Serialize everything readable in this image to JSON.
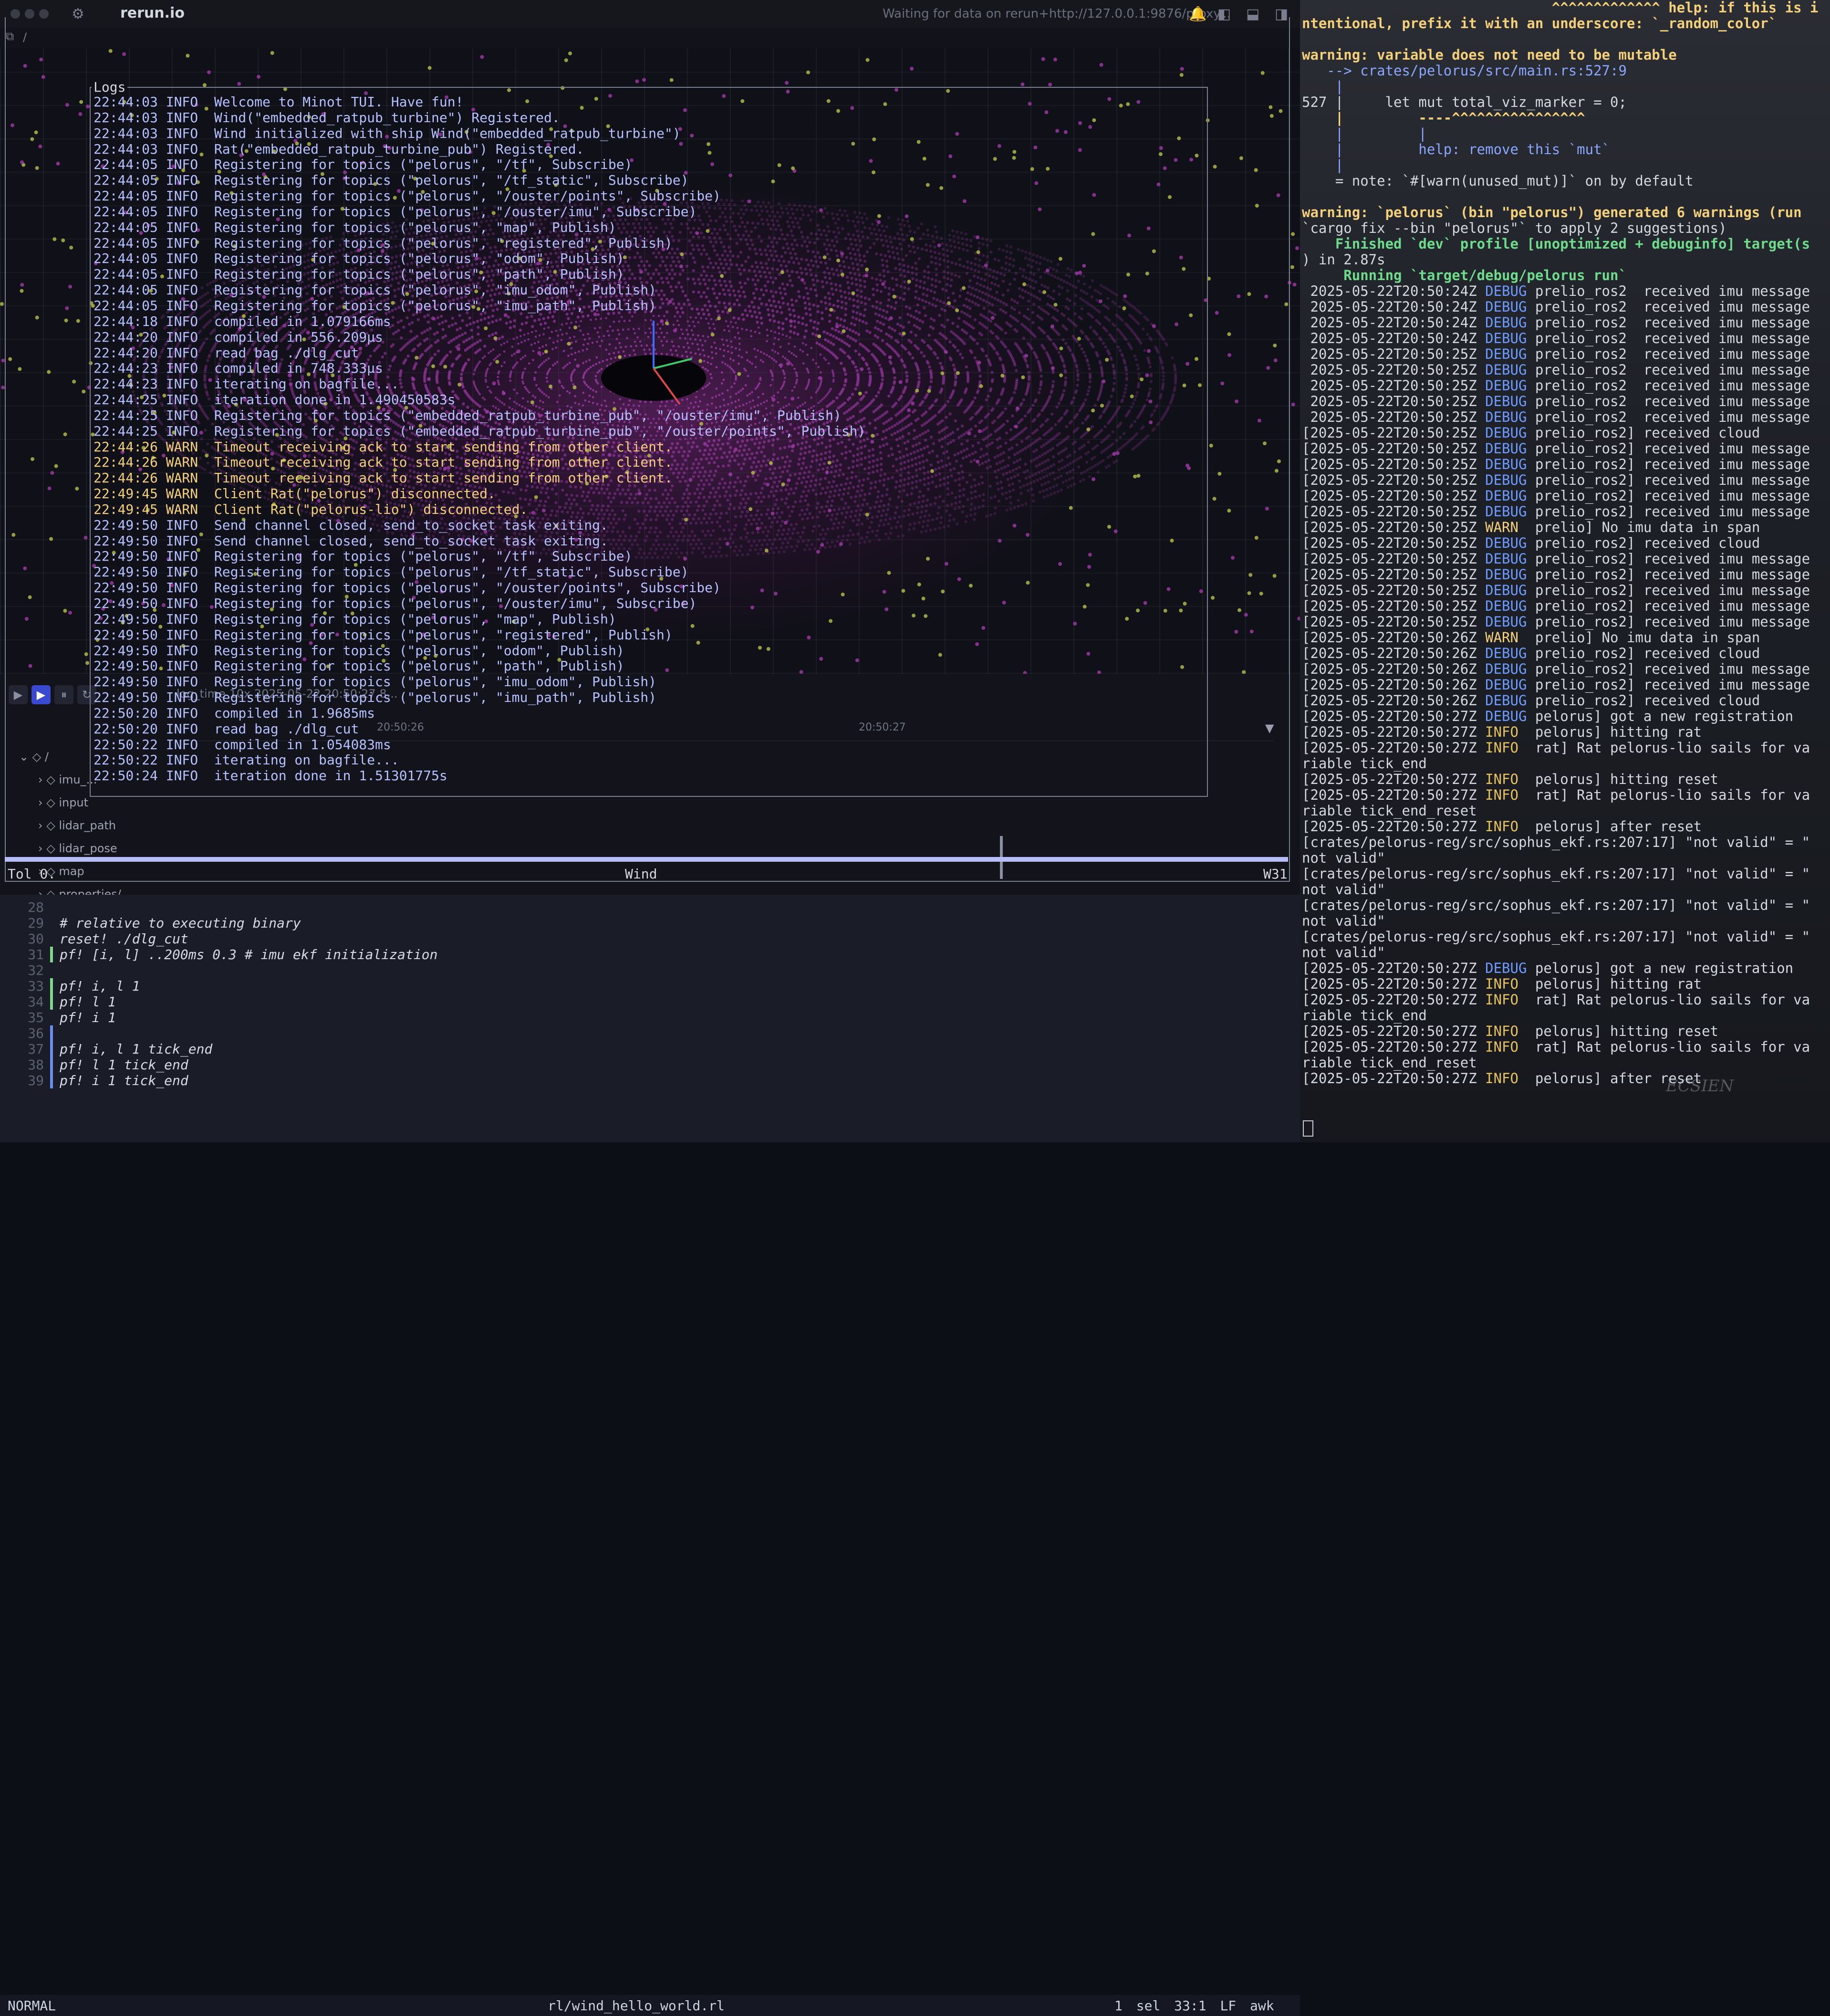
{
  "rerun": {
    "title": "rerun.io",
    "status": "Waiting for data on rerun+http://127.0.0.1:9876/proxy...",
    "path": "/",
    "timeline": {
      "labels": "log_time    10x    2025-05-22 20:50:27.8...",
      "tick_left": "20:50:26",
      "tick_right": "20:50:27",
      "tree": [
        "/",
        "imu_...",
        "input",
        "lidar_path",
        "lidar_pose",
        "map",
        "properties/"
      ]
    }
  },
  "logs": {
    "title": "Logs",
    "lines": [
      {
        "text": "22:44:03 INFO  Welcome to Minot TUI. Have fun!",
        "level": "info"
      },
      {
        "text": "22:44:03 INFO  Wind(\"embedded_ratpub_turbine\") Registered.",
        "level": "info"
      },
      {
        "text": "22:44:03 INFO  Wind initialized with ship Wind(\"embedded_ratpub_turbine\")",
        "level": "info"
      },
      {
        "text": "22:44:03 INFO  Rat(\"embedded_ratpub_turbine_pub\") Registered.",
        "level": "info"
      },
      {
        "text": "22:44:05 INFO  Registering for topics (\"pelorus\", \"/tf\", Subscribe)",
        "level": "info"
      },
      {
        "text": "22:44:05 INFO  Registering for topics (\"pelorus\", \"/tf_static\", Subscribe)",
        "level": "info"
      },
      {
        "text": "22:44:05 INFO  Registering for topics (\"pelorus\", \"/ouster/points\", Subscribe)",
        "level": "info"
      },
      {
        "text": "22:44:05 INFO  Registering for topics (\"pelorus\", \"/ouster/imu\", Subscribe)",
        "level": "info"
      },
      {
        "text": "22:44:05 INFO  Registering for topics (\"pelorus\", \"map\", Publish)",
        "level": "info"
      },
      {
        "text": "22:44:05 INFO  Registering for topics (\"pelorus\", \"registered\", Publish)",
        "level": "info"
      },
      {
        "text": "22:44:05 INFO  Registering for topics (\"pelorus\", \"odom\", Publish)",
        "level": "info"
      },
      {
        "text": "22:44:05 INFO  Registering for topics (\"pelorus\", \"path\", Publish)",
        "level": "info"
      },
      {
        "text": "22:44:05 INFO  Registering for topics (\"pelorus\", \"imu_odom\", Publish)",
        "level": "info"
      },
      {
        "text": "22:44:05 INFO  Registering for topics (\"pelorus\", \"imu_path\", Publish)",
        "level": "info"
      },
      {
        "text": "22:44:18 INFO  compiled in 1.079166ms",
        "level": "info"
      },
      {
        "text": "22:44:20 INFO  compiled in 556.209µs",
        "level": "info"
      },
      {
        "text": "22:44:20 INFO  read bag ./dlg_cut",
        "level": "info"
      },
      {
        "text": "22:44:23 INFO  compiled in 748.333µs",
        "level": "info"
      },
      {
        "text": "22:44:23 INFO  iterating on bagfile...",
        "level": "info"
      },
      {
        "text": "22:44:25 INFO  iteration done in 1.490450583s",
        "level": "info"
      },
      {
        "text": "22:44:25 INFO  Registering for topics (\"embedded_ratpub_turbine_pub\", \"/ouster/imu\", Publish)",
        "level": "info"
      },
      {
        "text": "22:44:25 INFO  Registering for topics (\"embedded_ratpub_turbine_pub\", \"/ouster/points\", Publish)",
        "level": "info"
      },
      {
        "text": "22:44:26 WARN  Timeout receiving ack to start sending from other client.",
        "level": "warn"
      },
      {
        "text": "22:44:26 WARN  Timeout receiving ack to start sending from other client.",
        "level": "warn"
      },
      {
        "text": "22:44:26 WARN  Timeout receiving ack to start sending from other client.",
        "level": "warn"
      },
      {
        "text": "22:49:45 WARN  Client Rat(\"pelorus\") disconnected.",
        "level": "warn"
      },
      {
        "text": "22:49:45 WARN  Client Rat(\"pelorus-lio\") disconnected.",
        "level": "warn"
      },
      {
        "text": "22:49:50 INFO  Send channel closed, send_to_socket task exiting.",
        "level": "info"
      },
      {
        "text": "22:49:50 INFO  Send channel closed, send_to_socket task exiting.",
        "level": "info"
      },
      {
        "text": "22:49:50 INFO  Registering for topics (\"pelorus\", \"/tf\", Subscribe)",
        "level": "info"
      },
      {
        "text": "22:49:50 INFO  Registering for topics (\"pelorus\", \"/tf_static\", Subscribe)",
        "level": "info"
      },
      {
        "text": "22:49:50 INFO  Registering for topics (\"pelorus\", \"/ouster/points\", Subscribe)",
        "level": "info"
      },
      {
        "text": "22:49:50 INFO  Registering for topics (\"pelorus\", \"/ouster/imu\", Subscribe)",
        "level": "info"
      },
      {
        "text": "22:49:50 INFO  Registering for topics (\"pelorus\", \"map\", Publish)",
        "level": "info"
      },
      {
        "text": "22:49:50 INFO  Registering for topics (\"pelorus\", \"registered\", Publish)",
        "level": "info"
      },
      {
        "text": "22:49:50 INFO  Registering for topics (\"pelorus\", \"odom\", Publish)",
        "level": "info"
      },
      {
        "text": "22:49:50 INFO  Registering for topics (\"pelorus\", \"path\", Publish)",
        "level": "info"
      },
      {
        "text": "22:49:50 INFO  Registering for topics (\"pelorus\", \"imu_odom\", Publish)",
        "level": "info"
      },
      {
        "text": "22:49:50 INFO  Registering for topics (\"pelorus\", \"imu_path\", Publish)",
        "level": "info"
      },
      {
        "text": "22:50:20 INFO  compiled in 1.9685ms",
        "level": "info"
      },
      {
        "text": "22:50:20 INFO  read bag ./dlg_cut",
        "level": "info"
      },
      {
        "text": "22:50:22 INFO  compiled in 1.054083ms",
        "level": "info"
      },
      {
        "text": "22:50:22 INFO  iterating on bagfile...",
        "level": "info"
      },
      {
        "text": "22:50:24 INFO  iteration done in 1.51301775s",
        "level": "info"
      }
    ]
  },
  "wind": {
    "left": "Tol 0.",
    "center": "Wind",
    "right": "W31"
  },
  "editor": {
    "lines": [
      {
        "num": "28",
        "code": "",
        "bar": ""
      },
      {
        "num": "29",
        "code": "# relative to executing binary",
        "bar": ""
      },
      {
        "num": "30",
        "code": "reset! ./dlg_cut",
        "bar": ""
      },
      {
        "num": "31",
        "code": "pf! [i, l] ..200ms 0.3 # imu ekf initialization",
        "bar": "green"
      },
      {
        "num": "32",
        "code": "",
        "bar": ""
      },
      {
        "num": "33",
        "code": "pf! i, l 1",
        "bar": "green"
      },
      {
        "num": "34",
        "code": "pf! l 1",
        "bar": "green"
      },
      {
        "num": "35",
        "code": "pf! i 1",
        "bar": ""
      },
      {
        "num": "36",
        "code": "",
        "bar": "blue"
      },
      {
        "num": "37",
        "code": "pf! i, l 1 tick_end",
        "bar": "blue"
      },
      {
        "num": "38",
        "code": "pf! l 1 tick_end",
        "bar": "blue"
      },
      {
        "num": "39",
        "code": "pf! i 1 tick_end",
        "bar": "blue"
      }
    ],
    "status": {
      "mode": "NORMAL",
      "file": "rl/wind_hello_world.rl",
      "sel": "1 sel",
      "pos": "33:1",
      "eol": "LF",
      "lang": "awk"
    }
  },
  "terminal": {
    "lines": [
      {
        "cls": "c-warn",
        "text": "                              ^^^^^^^^^^^^^ help: if this is i"
      },
      {
        "cls": "c-warn",
        "text": "ntentional, prefix it with an underscore: `_random_color`"
      },
      {
        "cls": "",
        "text": ""
      },
      {
        "cls": "c-warn",
        "text": "warning: variable does not need to be mutable"
      },
      {
        "cls": "c-blue",
        "text": "   --> crates/pelorus/src/main.rs:527:9"
      },
      {
        "cls": "c-blue",
        "text": "    |"
      },
      {
        "cls": "",
        "text": "527 |     let mut total_viz_marker = 0;"
      },
      {
        "cls": "c-warn",
        "text": "    |         ----^^^^^^^^^^^^^^^^"
      },
      {
        "cls": "c-blue",
        "text": "    |         |"
      },
      {
        "cls": "c-blue",
        "text": "    |         help: remove this `mut`"
      },
      {
        "cls": "c-blue",
        "text": "    |"
      },
      {
        "cls": "",
        "text": "    = note: `#[warn(unused_mut)]` on by default"
      },
      {
        "cls": "",
        "text": ""
      },
      {
        "cls": "c-warn",
        "text": "warning: `pelorus` (bin \"pelorus\") generated 6 warnings (run"
      },
      {
        "cls": "",
        "text": "`cargo fix --bin \"pelorus\"` to apply 2 suggestions)"
      },
      {
        "cls": "c-green",
        "text": "    Finished `dev` profile [unoptimized + debuginfo] target(s"
      },
      {
        "cls": "",
        "text": ") in 2.87s"
      },
      {
        "cls": "c-green",
        "text": "     Running `target/debug/pelorus run`"
      },
      {
        "cls": "log",
        "text": " 2025-05-22T20:50:24Z DEBUG prelio_ros2  received imu message"
      },
      {
        "cls": "log",
        "text": " 2025-05-22T20:50:24Z DEBUG prelio_ros2  received imu message"
      },
      {
        "cls": "log",
        "text": " 2025-05-22T20:50:24Z DEBUG prelio_ros2  received imu message"
      },
      {
        "cls": "log",
        "text": " 2025-05-22T20:50:24Z DEBUG prelio_ros2  received imu message"
      },
      {
        "cls": "log",
        "text": " 2025-05-22T20:50:25Z DEBUG prelio_ros2  received imu message"
      },
      {
        "cls": "log",
        "text": " 2025-05-22T20:50:25Z DEBUG prelio_ros2  received imu message"
      },
      {
        "cls": "log",
        "text": " 2025-05-22T20:50:25Z DEBUG prelio_ros2  received imu message"
      },
      {
        "cls": "log",
        "text": " 2025-05-22T20:50:25Z DEBUG prelio_ros2  received imu message"
      },
      {
        "cls": "log",
        "text": " 2025-05-22T20:50:25Z DEBUG prelio_ros2  received imu message"
      },
      {
        "cls": "log",
        "text": "[2025-05-22T20:50:25Z DEBUG prelio_ros2] received cloud"
      },
      {
        "cls": "log",
        "text": "[2025-05-22T20:50:25Z DEBUG prelio_ros2] received imu message"
      },
      {
        "cls": "log",
        "text": "[2025-05-22T20:50:25Z DEBUG prelio_ros2] received imu message"
      },
      {
        "cls": "log",
        "text": "[2025-05-22T20:50:25Z DEBUG prelio_ros2] received imu message"
      },
      {
        "cls": "log",
        "text": "[2025-05-22T20:50:25Z DEBUG prelio_ros2] received imu message"
      },
      {
        "cls": "log",
        "text": "[2025-05-22T20:50:25Z DEBUG prelio_ros2] received imu message"
      },
      {
        "cls": "log",
        "text": "[2025-05-22T20:50:25Z WARN  prelio] No imu data in span"
      },
      {
        "cls": "log",
        "text": "[2025-05-22T20:50:25Z DEBUG prelio_ros2] received cloud"
      },
      {
        "cls": "log",
        "text": "[2025-05-22T20:50:25Z DEBUG prelio_ros2] received imu message"
      },
      {
        "cls": "log",
        "text": "[2025-05-22T20:50:25Z DEBUG prelio_ros2] received imu message"
      },
      {
        "cls": "log",
        "text": "[2025-05-22T20:50:25Z DEBUG prelio_ros2] received imu message"
      },
      {
        "cls": "log",
        "text": "[2025-05-22T20:50:25Z DEBUG prelio_ros2] received imu message"
      },
      {
        "cls": "log",
        "text": "[2025-05-22T20:50:25Z DEBUG prelio_ros2] received imu message"
      },
      {
        "cls": "log",
        "text": "[2025-05-22T20:50:26Z WARN  prelio] No imu data in span"
      },
      {
        "cls": "log",
        "text": "[2025-05-22T20:50:26Z DEBUG prelio_ros2] received cloud"
      },
      {
        "cls": "log",
        "text": "[2025-05-22T20:50:26Z DEBUG prelio_ros2] received imu message"
      },
      {
        "cls": "log",
        "text": "[2025-05-22T20:50:26Z DEBUG prelio_ros2] received imu message"
      },
      {
        "cls": "log",
        "text": "[2025-05-22T20:50:26Z DEBUG prelio_ros2] received cloud"
      },
      {
        "cls": "log",
        "text": "[2025-05-22T20:50:27Z DEBUG pelorus] got a new registration"
      },
      {
        "cls": "log",
        "text": "[2025-05-22T20:50:27Z INFO  pelorus] hitting rat"
      },
      {
        "cls": "log",
        "text": "[2025-05-22T20:50:27Z INFO  rat] Rat pelorus-lio sails for va"
      },
      {
        "cls": "",
        "text": "riable tick_end"
      },
      {
        "cls": "log",
        "text": "[2025-05-22T20:50:27Z INFO  pelorus] hitting reset"
      },
      {
        "cls": "log",
        "text": "[2025-05-22T20:50:27Z INFO  rat] Rat pelorus-lio sails for va"
      },
      {
        "cls": "",
        "text": "riable tick_end_reset"
      },
      {
        "cls": "log",
        "text": "[2025-05-22T20:50:27Z INFO  pelorus] after reset"
      },
      {
        "cls": "",
        "text": "[crates/pelorus-reg/src/sophus_ekf.rs:207:17] \"not valid\" = \""
      },
      {
        "cls": "",
        "text": "not valid\""
      },
      {
        "cls": "",
        "text": "[crates/pelorus-reg/src/sophus_ekf.rs:207:17] \"not valid\" = \""
      },
      {
        "cls": "",
        "text": "not valid\""
      },
      {
        "cls": "",
        "text": "[crates/pelorus-reg/src/sophus_ekf.rs:207:17] \"not valid\" = \""
      },
      {
        "cls": "",
        "text": "not valid\""
      },
      {
        "cls": "",
        "text": "[crates/pelorus-reg/src/sophus_ekf.rs:207:17] \"not valid\" = \""
      },
      {
        "cls": "",
        "text": "not valid\""
      },
      {
        "cls": "log",
        "text": "[2025-05-22T20:50:27Z DEBUG pelorus] got a new registration"
      },
      {
        "cls": "log",
        "text": "[2025-05-22T20:50:27Z INFO  pelorus] hitting rat"
      },
      {
        "cls": "log",
        "text": "[2025-05-22T20:50:27Z INFO  rat] Rat pelorus-lio sails for va"
      },
      {
        "cls": "",
        "text": "riable tick_end"
      },
      {
        "cls": "log",
        "text": "[2025-05-22T20:50:27Z INFO  pelorus] hitting reset"
      },
      {
        "cls": "log",
        "text": "[2025-05-22T20:50:27Z INFO  rat] Rat pelorus-lio sails for va"
      },
      {
        "cls": "",
        "text": "riable tick_end_reset"
      },
      {
        "cls": "log",
        "text": "[2025-05-22T20:50:27Z INFO  pelorus] after reset"
      }
    ],
    "watermark": "ECSIEN"
  },
  "colors": {
    "accent": "#b7bdf8",
    "info": "#b6c1ff",
    "warn": "#f5d07a",
    "point_cloud": "#a03aa8",
    "point_marker": "#b9c24a"
  }
}
